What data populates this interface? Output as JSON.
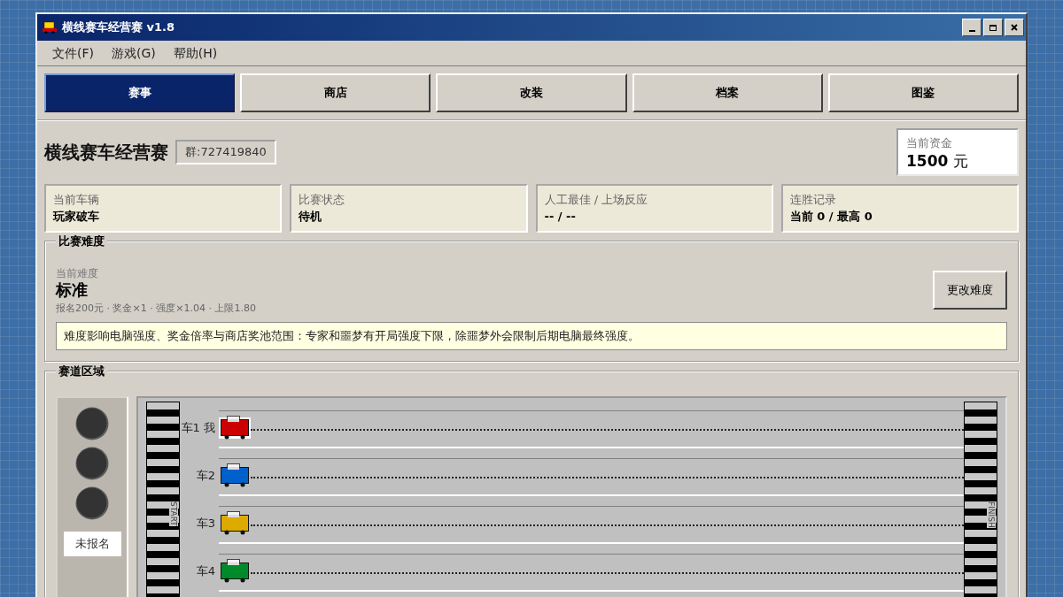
{
  "window": {
    "title": "横线赛车经营赛 v1.8"
  },
  "menu": [
    {
      "label": "文件(F)"
    },
    {
      "label": "游戏(G)"
    },
    {
      "label": "帮助(H)"
    }
  ],
  "tabs": [
    {
      "label": "赛事",
      "selected": true
    },
    {
      "label": "商店",
      "selected": false
    },
    {
      "label": "改装",
      "selected": false
    },
    {
      "label": "档案",
      "selected": false
    },
    {
      "label": "图鉴",
      "selected": false
    }
  ],
  "header": {
    "title": "横线赛车经营赛",
    "group": "群:727419840",
    "funds": {
      "label": "当前资金",
      "value": "**1500** 元"
    }
  },
  "stats": [
    {
      "label": "当前车辆",
      "value": "玩家破车"
    },
    {
      "label": "比赛状态",
      "value": "待机"
    },
    {
      "label": "人工最佳 / 上场反应",
      "value": "-- / --"
    },
    {
      "label": "连胜记录",
      "value": "当前 0 / 最高 0"
    }
  ],
  "difficulty": {
    "legend": "比赛难度",
    "label": "当前难度",
    "name": "标准",
    "details": "报名200元 · 奖金×1 · 强度×1.04 · 上限1.80",
    "button": "更改难度",
    "note": "难度影响电脑强度、奖金倍率与商店奖池范围：专家和噩梦有开局强度下限，除噩梦外会限制后期电脑最终强度。"
  },
  "track": {
    "legend": "赛道区域",
    "lights": [
      {
        "on": false
      },
      {
        "on": false
      },
      {
        "on": false
      }
    ],
    "status": "未报名",
    "start_label": "START",
    "finish_label": "FINISH",
    "cars": [
      {
        "label": "车1 我",
        "color": "#cc0000",
        "player": true,
        "level": 0
      },
      {
        "label": "车2",
        "color": "#0060cc",
        "player": false,
        "level": 0
      },
      {
        "label": "车3",
        "color": "#ddaa00",
        "player": false,
        "level": 0
      },
      {
        "label": "车4",
        "color": "#008a2a",
        "player": false,
        "level": 0
      }
    ]
  }
}
